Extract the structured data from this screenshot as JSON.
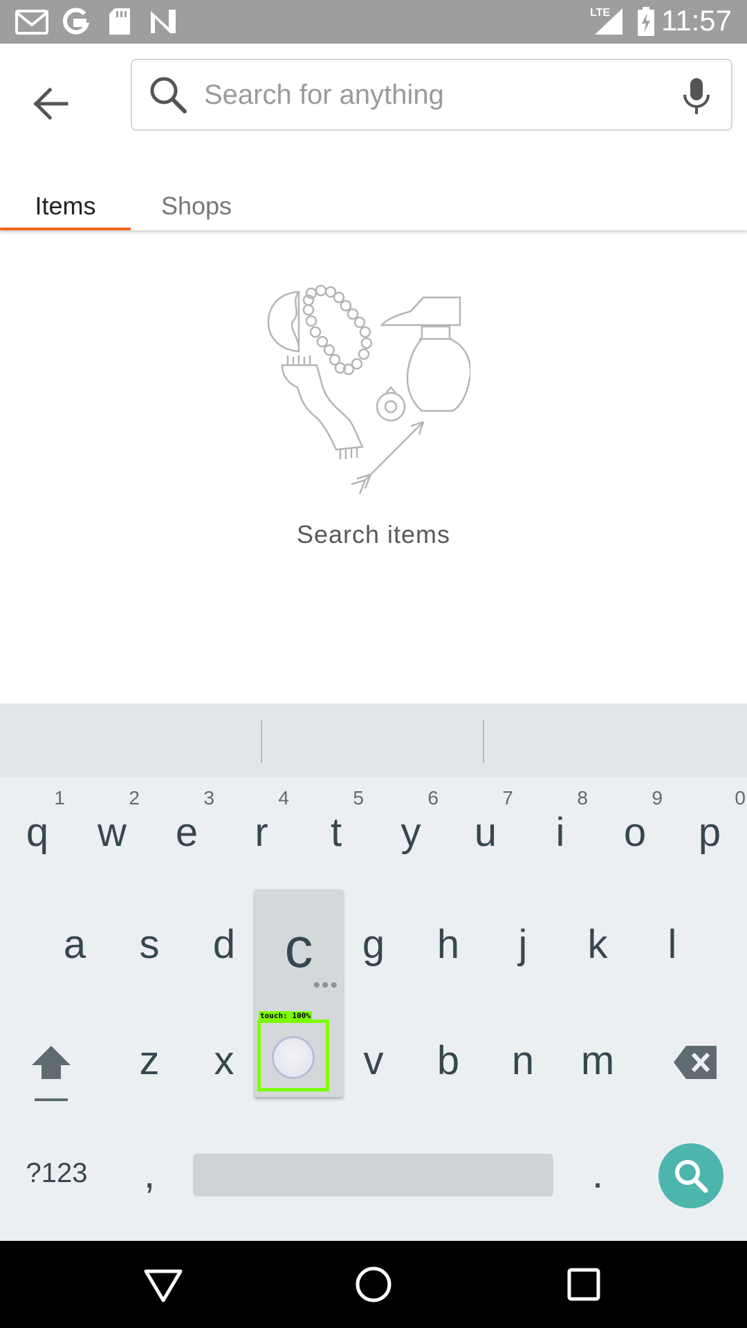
{
  "status_bar": {
    "time": "11:57",
    "network": "LTE",
    "left_icons": [
      "gmail-icon",
      "google-icon",
      "sd-card-icon",
      "n-icon"
    ],
    "right_icons": [
      "lte-signal-icon",
      "battery-charging-icon"
    ]
  },
  "search": {
    "placeholder": "Search for anything",
    "value": ""
  },
  "tabs": [
    {
      "label": "Items",
      "selected": true
    },
    {
      "label": "Shops",
      "selected": false
    }
  ],
  "empty_state": {
    "text": "Search items"
  },
  "keyboard": {
    "row1": [
      {
        "k": "q",
        "hint": "1"
      },
      {
        "k": "w",
        "hint": "2"
      },
      {
        "k": "e",
        "hint": "3"
      },
      {
        "k": "r",
        "hint": "4"
      },
      {
        "k": "t",
        "hint": "5"
      },
      {
        "k": "y",
        "hint": "6"
      },
      {
        "k": "u",
        "hint": "7"
      },
      {
        "k": "i",
        "hint": "8"
      },
      {
        "k": "o",
        "hint": "9"
      },
      {
        "k": "p",
        "hint": "0"
      }
    ],
    "row2": [
      "a",
      "s",
      "d",
      "f",
      "g",
      "h",
      "j",
      "k",
      "l"
    ],
    "row3": [
      "z",
      "x",
      "c",
      "v",
      "b",
      "n",
      "m"
    ],
    "popup_key": "c",
    "symbols_label": "?123",
    "comma_label": ",",
    "period_label": ".",
    "touch_overlay": "touch: 100%"
  },
  "colors": {
    "accent": "#f1641e",
    "search_action": "#4db6ac",
    "keyboard_bg": "#eceff1"
  }
}
